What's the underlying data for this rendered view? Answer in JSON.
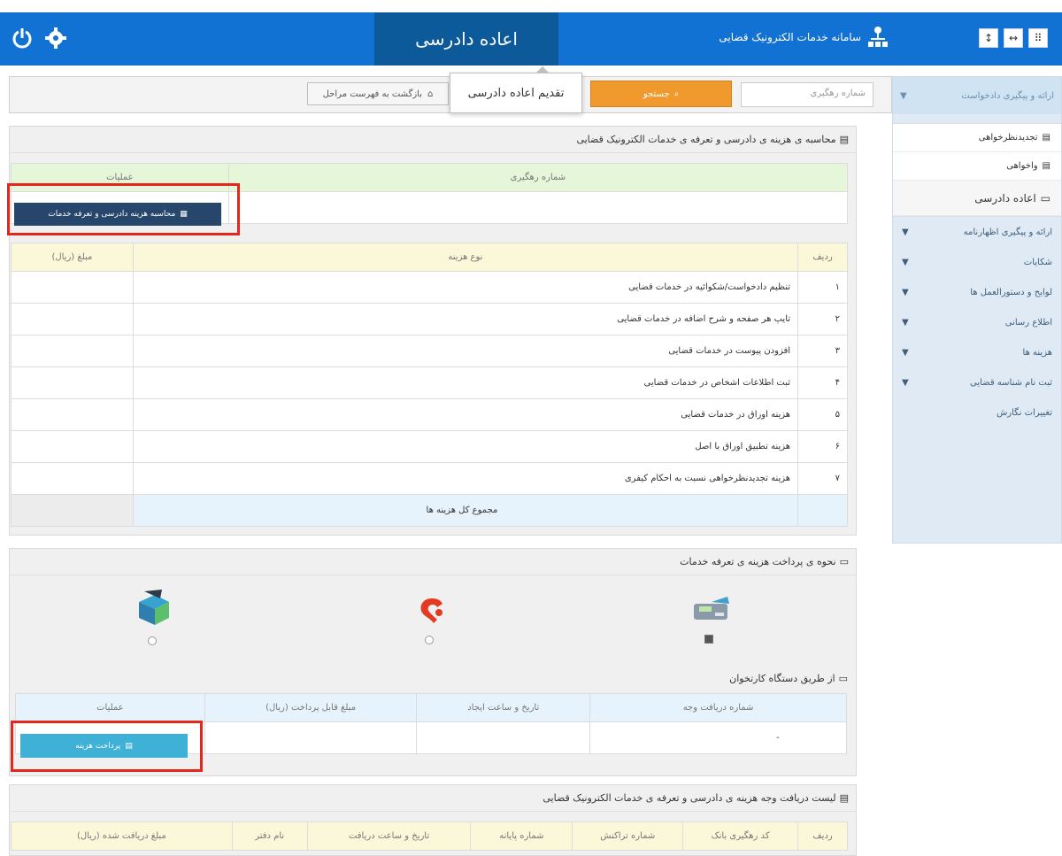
{
  "topbar": {
    "active_title": "اعاده دادرسی",
    "site_title": "سامانه خدمات الکترونیک قضایی",
    "power_icon": "power-icon",
    "settings_icon": "gear-icon",
    "window_buttons": [
      "↕",
      "↔",
      "⠿"
    ]
  },
  "popover": {
    "label": "تقدیم اعاده دادرسی"
  },
  "toolbar": {
    "tracking_placeholder": "شماره رهگیری",
    "search_label": "جستجو",
    "back_label": "بازگشت به فهرست مراحل"
  },
  "sidebar": {
    "head_label": "ارائه و پیگیری دادخواست",
    "sub_items": [
      "تجدیدنظرخواهی",
      "واخواهی",
      "اعاده دادرسی"
    ],
    "menu_items": [
      "ارائه و پیگیری اظهارنامه",
      "شکایات",
      "لوایح و دستورالعمل ها",
      "اطلاع رسانی",
      "هزینه ها",
      "ثبت نام شناسه قضایی",
      "تغییرات نگارش"
    ]
  },
  "calc_panel": {
    "title": "محاسبه ی هزینه ی دادرسی و تعرفه ی خدمات الکترونیک قضایی",
    "col_tracking": "شماره رهگیری",
    "col_operations": "عملیات",
    "calc_button": "محاسبه هزینه دادرسی و تعرفه خدمات"
  },
  "fees_table": {
    "headers": [
      "ردیف",
      "نوع هزینه",
      "مبلغ (ریال)"
    ],
    "rows": [
      [
        "۱",
        "تنظیم دادخواست/شکوائیه در خدمات قضایی"
      ],
      [
        "۲",
        "تایپ هر صفحه و شرح اضافه در خدمات قضایی"
      ],
      [
        "۳",
        "افزودن پیوست در خدمات قضایی"
      ],
      [
        "۴",
        "ثبت اطلاعات اشخاص در خدمات قضایی"
      ],
      [
        "۵",
        "هزینه اوراق در خدمات قضایی"
      ],
      [
        "۶",
        "هزینه تطبیق اوراق با اصل"
      ],
      [
        "۷",
        "هزینه تجدیدنظرخواهی نسبت به احکام کیفری"
      ]
    ],
    "total_label": "مجموع کل هزینه ها"
  },
  "payment_panel": {
    "title": "نحوه ی پرداخت هزینه ی تعرفه خدمات",
    "methods": [
      "pos-terminal-icon",
      "online-pay-icon",
      "bank-deposit-icon"
    ],
    "method_selected": [
      true,
      false,
      false
    ],
    "subtitle": "از طریق دستگاه کارتخوان",
    "headers": [
      "شماره دریافت وجه",
      "تاریخ و ساعت ایجاد",
      "مبلغ قابل پرداخت (ریال)",
      "عملیات"
    ],
    "row": [
      "-",
      "",
      "",
      ""
    ],
    "pay_button": "پرداخت هزینه"
  },
  "receipt_panel": {
    "title": "لیست دریافت وجه هزینه ی دادرسی و تعرفه ی خدمات الکترونیک قضایی",
    "headers": [
      "ردیف",
      "کد رهگیری بانک",
      "شماره تراکنش",
      "شماره پایانه",
      "تاریخ و ساعت دریافت",
      "نام دفتر",
      "مبلغ دریافت شده (ریال)"
    ]
  },
  "colors": {
    "topbar": "#1172d4",
    "active_tab": "#0d5a9b",
    "search": "#f09a2d",
    "calc_button": "#26466b",
    "pay_button": "#3fb0d6",
    "highlight": "#e2271c",
    "table_header": "#fbf7d9"
  }
}
